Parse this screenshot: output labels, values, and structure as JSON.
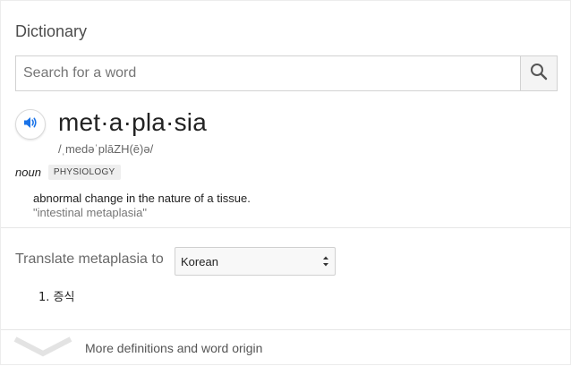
{
  "card": {
    "title": "Dictionary"
  },
  "search": {
    "placeholder": "Search for a word",
    "icon": "search-icon"
  },
  "entry": {
    "audio_icon": "speaker-icon",
    "headword": "met·a·pla·sia",
    "phonetic": "/ˌmedəˈplāZH(ē)ə/",
    "part_of_speech": "noun",
    "subject_label": "PHYSIOLOGY",
    "definition": "abnormal change in the nature of a tissue.",
    "example": "\"intestinal metaplasia\""
  },
  "translate": {
    "label": "Translate metaplasia to",
    "language": "Korean",
    "results": [
      "1. 증식"
    ]
  },
  "footer": {
    "more_label": "More definitions and word origin",
    "icon": "chevron-down-icon"
  },
  "colors": {
    "accent_blue": "#1a73e8",
    "text_dark": "#222222",
    "text_gray": "#6a6a6a",
    "divider": "#e6e6e6"
  }
}
